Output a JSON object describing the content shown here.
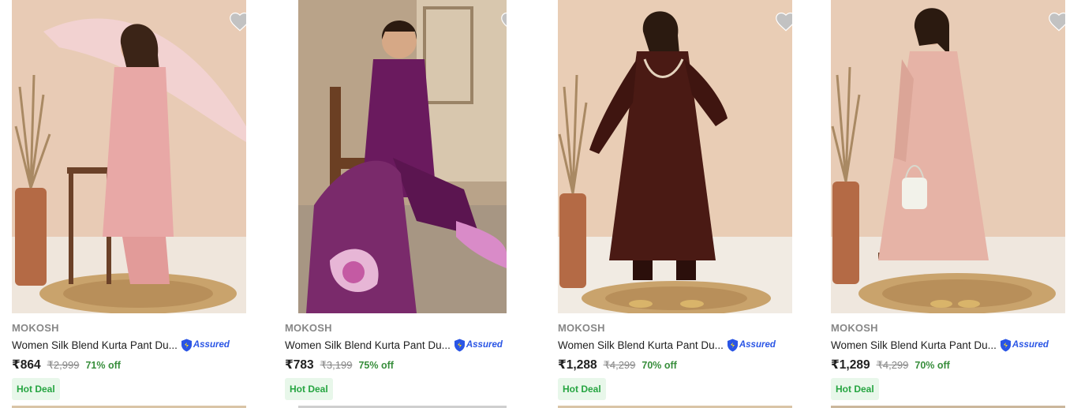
{
  "products": [
    {
      "brand": "MOKOSH",
      "title": "Women Silk Blend Kurta Pant Du...",
      "assured_label": "Assured",
      "price": "₹864",
      "mrp": "₹2,999",
      "discount": "71% off",
      "badge": "Hot Deal",
      "image_alt": "Woman in pink silk kurta set with printed dupatta",
      "colors": {
        "bg": "#e9cdb8",
        "floor": "#efe6dc",
        "dress": "#e8a8a6",
        "rug": "#c9a36c"
      }
    },
    {
      "brand": "MOKOSH",
      "title": "Women Silk Blend Kurta Pant Du...",
      "assured_label": "Assured",
      "price": "₹783",
      "mrp": "₹3,199",
      "discount": "75% off",
      "badge": "Hot Deal",
      "image_alt": "Woman in purple kurta set seated on a wooden chair",
      "colors": {
        "bg": "#c7b39a",
        "floor": "#a79683",
        "dress": "#6a1a5e",
        "rug": "#8a7868"
      }
    },
    {
      "brand": "MOKOSH",
      "title": "Women Silk Blend Kurta Pant Du...",
      "assured_label": "Assured",
      "price": "₹1,288",
      "mrp": "₹4,299",
      "discount": "70% off",
      "badge": "Hot Deal",
      "image_alt": "Woman in brown embroidered anarkali kurta set",
      "colors": {
        "bg": "#e9cdb5",
        "floor": "#f1ebe3",
        "dress": "#4a1a14",
        "rug": "#c9a36c"
      }
    },
    {
      "brand": "MOKOSH",
      "title": "Women Silk Blend Kurta Pant Du...",
      "assured_label": "Assured",
      "price": "₹1,289",
      "mrp": "₹4,299",
      "discount": "70% off",
      "badge": "Hot Deal",
      "image_alt": "Woman in peach anarkali kurta set holding a pouch",
      "colors": {
        "bg": "#e8ccb6",
        "floor": "#efe7de",
        "dress": "#e6b3a6",
        "rug": "#c9a36c"
      }
    }
  ]
}
